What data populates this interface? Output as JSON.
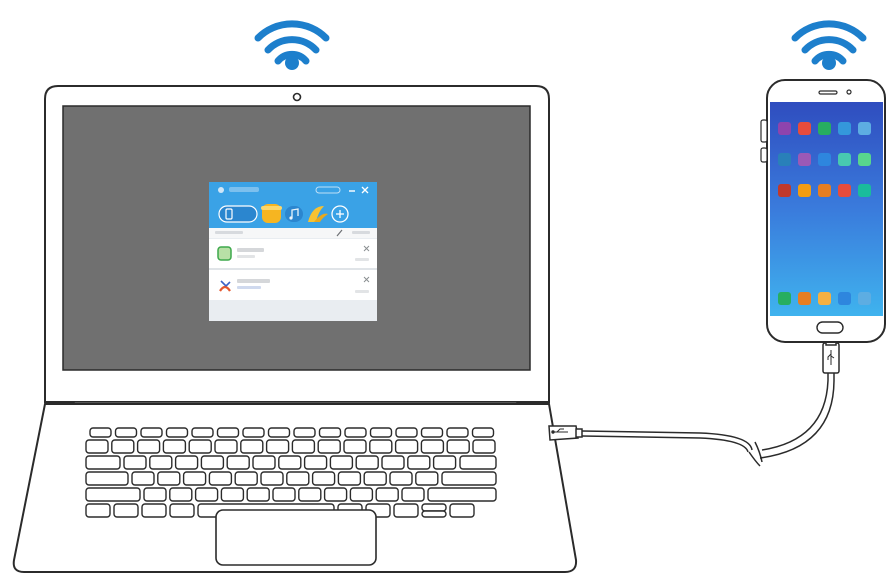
{
  "colors": {
    "wifi": "#1d7fcc",
    "outline": "#2b2b2b",
    "laptop_screen": "#6f6f6f",
    "window_header": "#3aa2e6",
    "phone_screen_top": "#2f4dbf",
    "phone_screen_bottom": "#3fb3ee"
  },
  "icons": {
    "wifi_left": "wifi-icon",
    "wifi_right": "wifi-icon",
    "usb": "usb-icon",
    "webcam": "webcam-icon"
  },
  "app_window": {
    "title": "",
    "tab_icons": [
      "phone-icon",
      "pot-icon",
      "music-icon",
      "banana-icon",
      "add-icon"
    ],
    "rows": [
      {
        "icon": "app-icon"
      },
      {
        "icon": "missed-call-icon"
      }
    ]
  }
}
